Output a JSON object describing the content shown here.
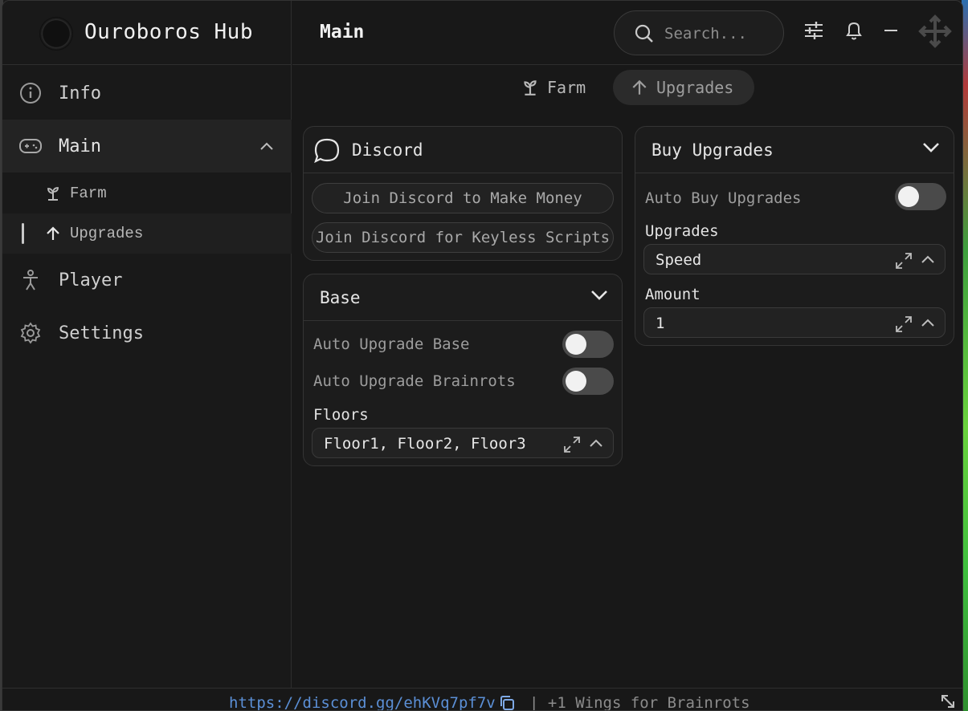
{
  "app": {
    "title": "Ouroboros Hub"
  },
  "header": {
    "title": "Main",
    "search_placeholder": "Search..."
  },
  "sidebar": {
    "items": [
      {
        "label": "Info",
        "icon": "info-icon"
      },
      {
        "label": "Main",
        "icon": "gamepad-icon"
      },
      {
        "label": "Player",
        "icon": "person-icon"
      },
      {
        "label": "Settings",
        "icon": "gear-icon"
      }
    ],
    "sub_items": [
      {
        "label": "Farm",
        "icon": "sprout-icon"
      },
      {
        "label": "Upgrades",
        "icon": "arrow-up-icon"
      }
    ]
  },
  "tabs": [
    {
      "label": "Farm",
      "icon": "sprout-icon"
    },
    {
      "label": "Upgrades",
      "icon": "arrow-up-icon",
      "active": true
    }
  ],
  "discord_panel": {
    "title": "Discord",
    "buttons": [
      "Join Discord to Make Money",
      "Join Discord for Keyless Scripts"
    ]
  },
  "base_panel": {
    "title": "Base",
    "toggles": [
      {
        "label": "Auto Upgrade Base",
        "on": false
      },
      {
        "label": "Auto Upgrade Brainrots",
        "on": false
      }
    ],
    "floors_label": "Floors",
    "floors_value": "Floor1, Floor2, Floor3"
  },
  "upgrades_panel": {
    "title": "Buy Upgrades",
    "toggle": {
      "label": "Auto Buy Upgrades",
      "on": false
    },
    "upgrades_label": "Upgrades",
    "upgrades_value": "Speed",
    "amount_label": "Amount",
    "amount_value": "1"
  },
  "footer": {
    "link": "https://discord.gg/ehKVq7pf7v",
    "text": "| +1 Wings for Brainrots"
  },
  "colors": {
    "accent_link": "#5b8fd6",
    "toggle_off": "#4a4a4a"
  }
}
